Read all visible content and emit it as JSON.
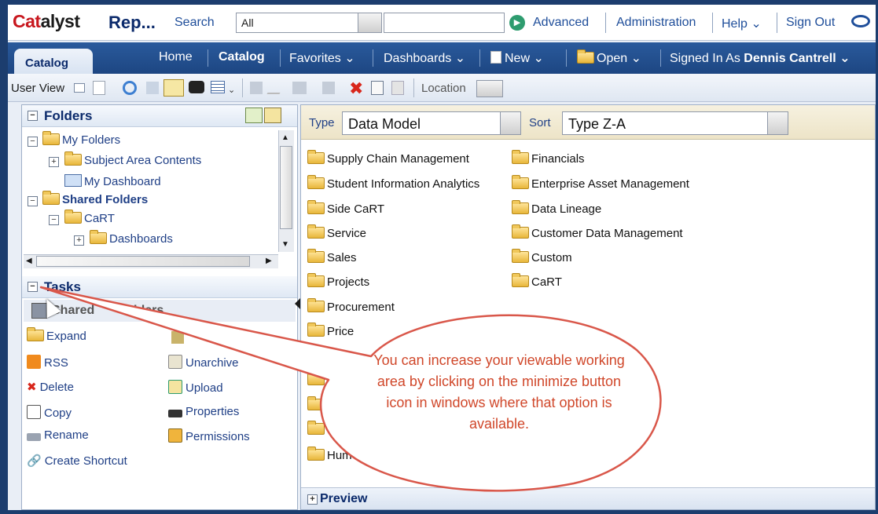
{
  "topbar": {
    "logo_prefix": "Cat",
    "logo_rest": "alyst",
    "app_name": "Rep...",
    "search_label": "Search",
    "search_scope": "All",
    "advanced": "Advanced",
    "administration": "Administration",
    "help": "Help ⌄",
    "sign_out": "Sign Out"
  },
  "tabbar": {
    "active_tab": "Catalog",
    "home": "Home",
    "catalog": "Catalog",
    "favorites": "Favorites ⌄",
    "dashboards": "Dashboards ⌄",
    "new": "New ⌄",
    "open": "Open ⌄",
    "signed_in_label": "Signed In As",
    "user": "Dennis Cantrell ⌄"
  },
  "toolbar": {
    "user_view": "User View",
    "location": "Location"
  },
  "folders_panel": {
    "title": "Folders",
    "tree": [
      {
        "label": "My Folders"
      },
      {
        "label": "Subject Area Contents"
      },
      {
        "label": "My Dashboard"
      },
      {
        "label": "Shared Folders"
      },
      {
        "label": "CaRT"
      },
      {
        "label": "Dashboards"
      }
    ]
  },
  "tasks_panel": {
    "title": "Tasks",
    "header_partial": "Shared",
    "header_partial_right": "lders",
    "left": [
      "Expand",
      "RSS",
      "Delete",
      "Copy",
      "Rename",
      "Create Shortcut"
    ],
    "right": [
      "Unarchive",
      "Upload",
      "Properties",
      "Permissions"
    ]
  },
  "filters": {
    "type_label": "Type",
    "type_value": "Data Model",
    "sort_label": "Sort",
    "sort_value": "Type Z-A"
  },
  "catalog_items": {
    "col1": [
      "Supply Chain Management",
      "Student Information Analytics",
      "Side CaRT",
      "Service",
      "Sales",
      "Projects",
      "Procurement",
      "Price"
    ],
    "col2": [
      "Financials",
      "Enterprise Asset Management",
      "Data Lineage",
      "Customer Data Management",
      "Custom",
      "CaRT"
    ],
    "partial_bottom": "Hum"
  },
  "preview": {
    "label": "Preview"
  },
  "callout": {
    "text": "You can increase your viewable working area by clicking on the minimize button icon in windows where that option is available."
  },
  "colors": {
    "accent_blue": "#1d4682",
    "callout_text": "#d0472a",
    "callout_border": "#d9574a"
  }
}
